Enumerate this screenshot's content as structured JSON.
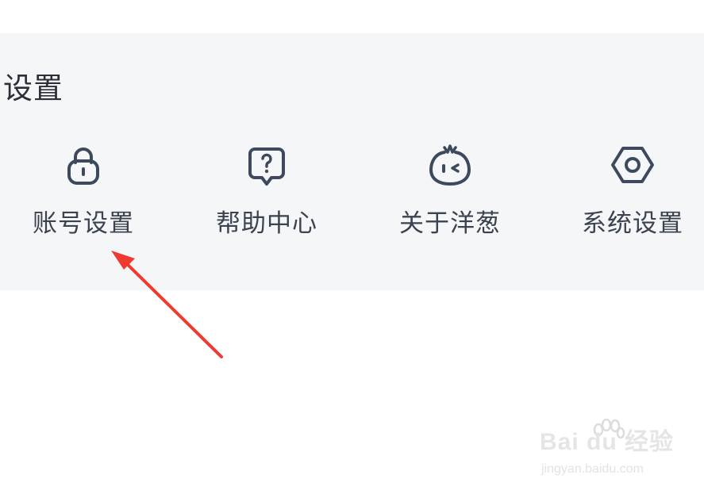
{
  "settings": {
    "title": "设置",
    "items": [
      {
        "label": "账号设置",
        "icon": "lock-icon"
      },
      {
        "label": "帮助中心",
        "icon": "help-question-icon"
      },
      {
        "label": "关于洋葱",
        "icon": "onion-mascot-icon"
      },
      {
        "label": "系统设置",
        "icon": "hexagon-settings-icon"
      }
    ]
  },
  "annotation": {
    "arrow_color": "#f03a2f"
  },
  "watermark": {
    "brand": "Bai du 经验",
    "url": "jingyan.baidu.com"
  },
  "colors": {
    "panel_bg": "#f5f6f8",
    "icon_stroke": "#3d4a5e",
    "text": "#3b4250"
  }
}
